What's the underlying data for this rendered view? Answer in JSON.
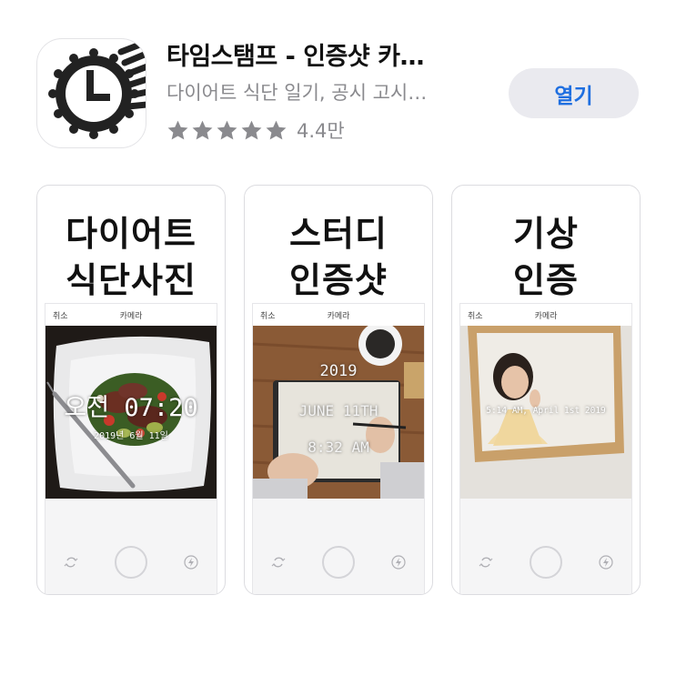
{
  "app": {
    "title": "타임스탬프 - 인증샷 카…",
    "subtitle": "다이어트 식단 일기, 공시 고시…",
    "rating_count": "4.4만",
    "rating_stars": 5,
    "open_label": "열기",
    "accent_color": "#1f6fe0"
  },
  "screenshots": [
    {
      "headline_line1": "다이어트",
      "headline_line2": "식단사진",
      "cancel": "취소",
      "camera": "카메라",
      "stamp_time": "오전 07:20",
      "stamp_date": "2019년 6월 11일"
    },
    {
      "headline_line1": "스터디",
      "headline_line2": "인증샷",
      "cancel": "취소",
      "camera": "카메라",
      "stamp_year": "2019",
      "stamp_date": "JUNE 11TH",
      "stamp_time": "8:32 AM"
    },
    {
      "headline_line1": "기상",
      "headline_line2": "인증",
      "cancel": "취소",
      "camera": "카메라",
      "stamp_text": "5:14 AM, April 1st 2019"
    }
  ]
}
